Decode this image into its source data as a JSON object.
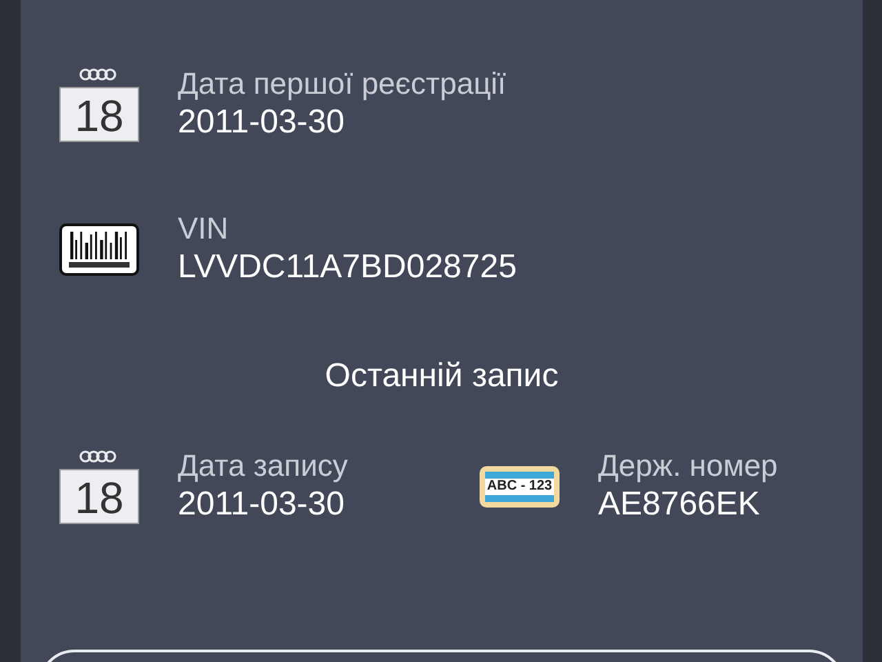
{
  "fields": [
    {
      "kind": "date",
      "label": "Дата першої реєстрації",
      "value": "2011-03-30",
      "icon_text": "18"
    },
    {
      "kind": "barcode",
      "label": "VIN",
      "value": "LVVDC11A7BD028725"
    }
  ],
  "last_record": {
    "title": "Останній запис",
    "fields": [
      {
        "kind": "date",
        "label": "Дата запису",
        "value": "2011-03-30",
        "icon_text": "18"
      },
      {
        "kind": "plate",
        "label": "Держ. номер",
        "value": "AE8766EK",
        "icon_text": "ABC - 123"
      }
    ]
  }
}
